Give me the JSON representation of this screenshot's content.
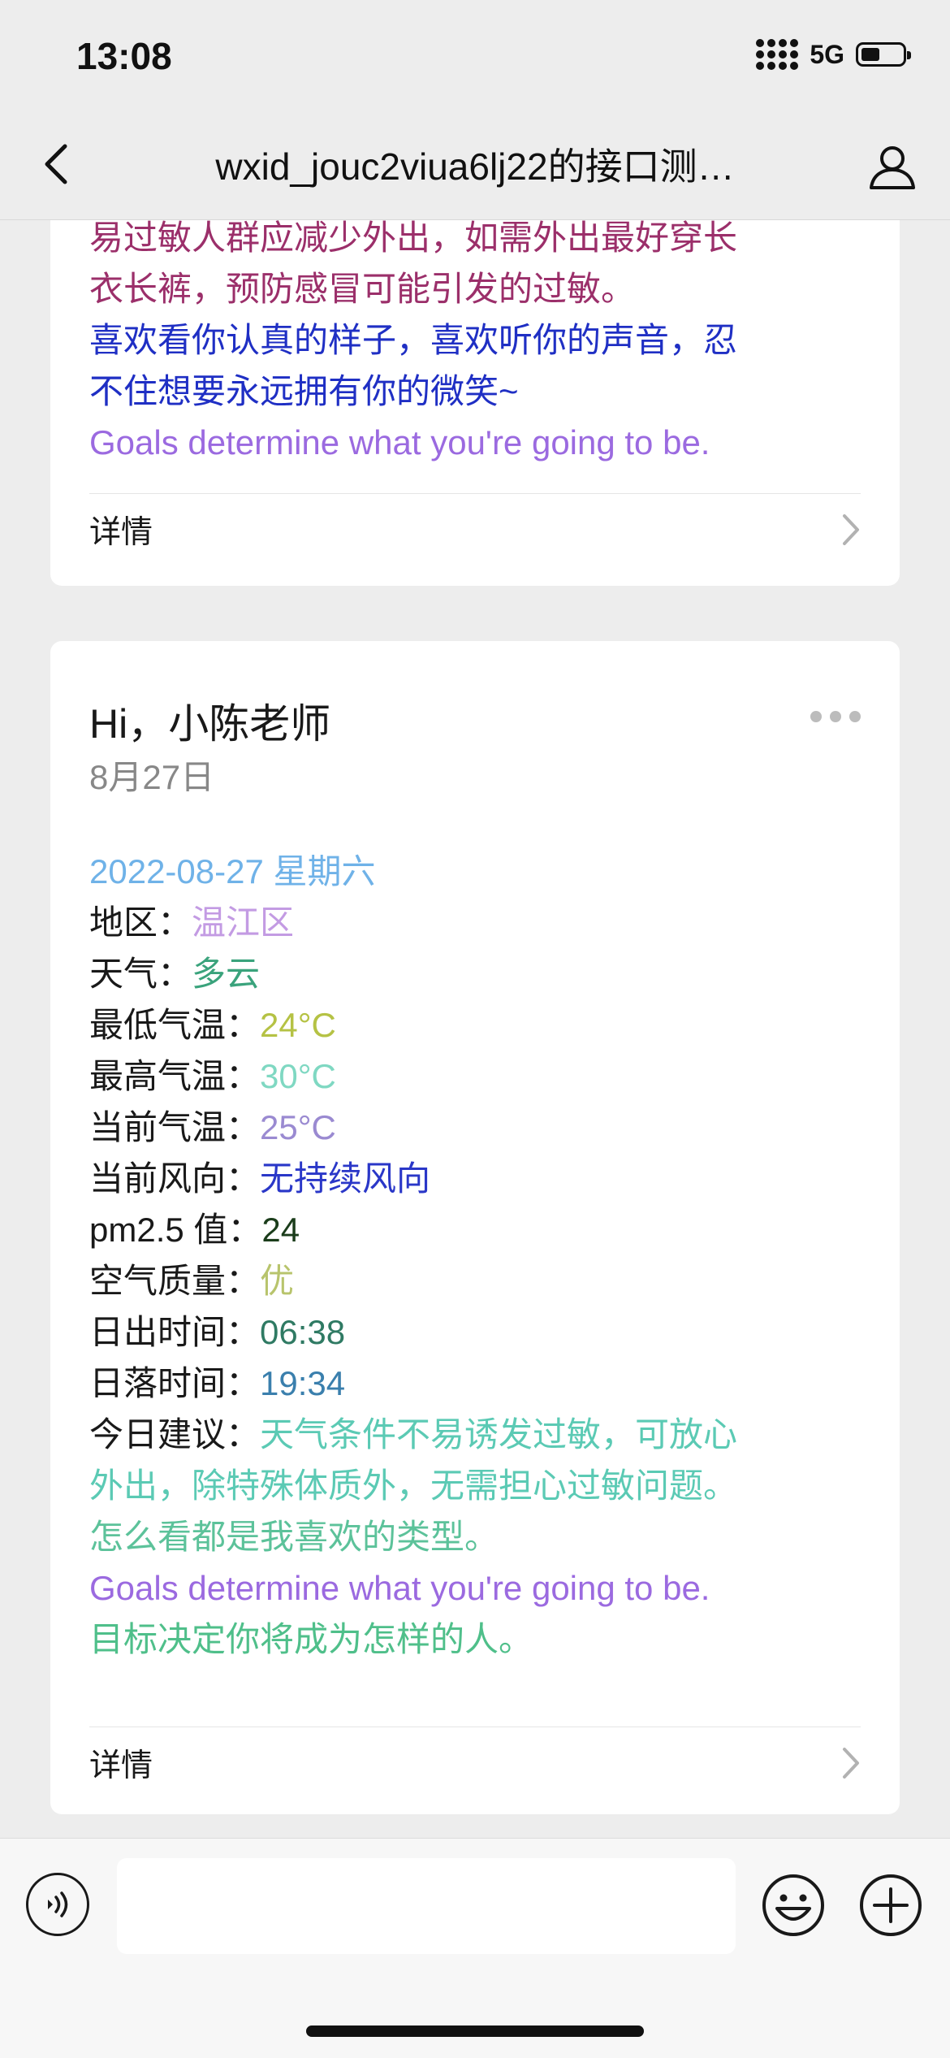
{
  "status_bar": {
    "time": "13:08",
    "network": "5G"
  },
  "nav": {
    "title": "wxid_jouc2viua6lj22的接口测…"
  },
  "card1": {
    "lines": [
      {
        "text": "易过敏人群应减少外出，如需外出最好穿长",
        "color": "#9b2f6a"
      },
      {
        "text": "衣长裤，预防感冒可能引发的过敏。",
        "color": "#9b2f6a"
      },
      {
        "text": "喜欢看你认真的样子，喜欢听你的声音，忍",
        "color": "#1f2fc4"
      },
      {
        "text": "不住想要永远拥有你的微笑~",
        "color": "#1f2fc4"
      },
      {
        "text": "Goals determine what you're going to be.",
        "color": "#9b6ae0"
      }
    ],
    "detail_label": "详情"
  },
  "card2": {
    "title": "Hi，小陈老师",
    "date": "8月27日",
    "date_line": "2022-08-27 星期六",
    "fields": [
      {
        "label": "地区：",
        "value": "温江区",
        "color": "#c39be3"
      },
      {
        "label": "天气：",
        "value": "多云",
        "color": "#3aa37c"
      },
      {
        "label": "最低气温：",
        "value": "24°C",
        "color": "#b5c244"
      },
      {
        "label": "最高气温：",
        "value": "30°C",
        "color": "#7fd8c2"
      },
      {
        "label": "当前气温：",
        "value": "25°C",
        "color": "#9a8ad1"
      },
      {
        "label": "当前风向：",
        "value": "无持续风向",
        "color": "#2a37c8"
      },
      {
        "label": "pm2.5 值：",
        "value": "24",
        "color": "#1b3d1b"
      },
      {
        "label": "空气质量：",
        "value": "优",
        "color": "#b8c46c"
      },
      {
        "label": "日出时间：",
        "value": "06:38",
        "color": "#2f7a63"
      },
      {
        "label": "日落时间：",
        "value": "19:34",
        "color": "#3a7fad"
      }
    ],
    "advice_label": "今日建议：",
    "advice_lines": [
      "天气条件不易诱发过敏，可放心",
      "外出，除特殊体质外，无需担心过敏问题。"
    ],
    "advice_color": "#5bcab4",
    "compliment": "怎么看都是我喜欢的类型。",
    "compliment_color": "#5cc29a",
    "quote_en": "Goals determine what you're going to be.",
    "quote_en_color": "#9b6ae0",
    "quote_cn": "目标决定你将成为怎样的人。",
    "quote_cn_color": "#4fbf8a",
    "date_line_color": "#6fb2e8",
    "detail_label": "详情"
  },
  "bottom_bar": {
    "input_value": ""
  }
}
